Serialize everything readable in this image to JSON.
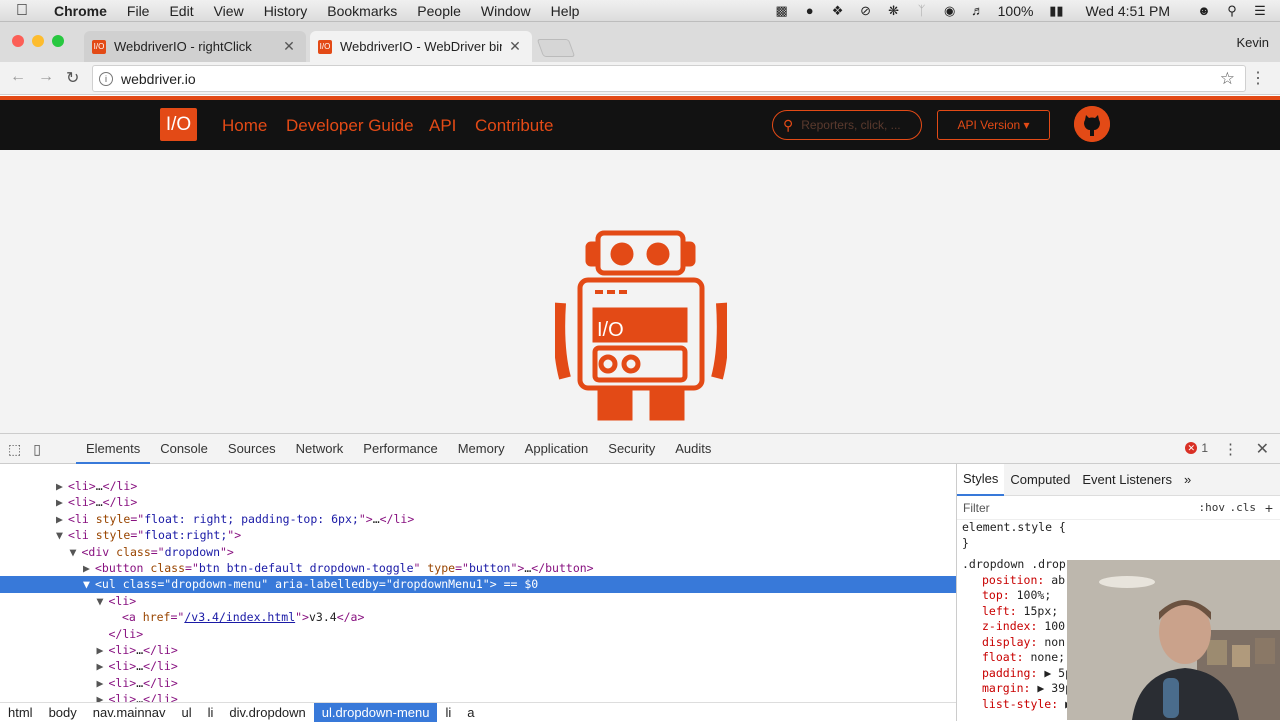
{
  "menubar": {
    "app": "Chrome",
    "items": [
      "File",
      "Edit",
      "View",
      "History",
      "Bookmarks",
      "People",
      "Window",
      "Help"
    ],
    "battery": "100%",
    "clock": "Wed 4:51 PM"
  },
  "tabs": [
    {
      "title": "WebdriverIO - rightClick",
      "favicon": "I/O"
    },
    {
      "title": "WebdriverIO - WebDriver bindi",
      "favicon": "I/O"
    }
  ],
  "profile": "Kevin",
  "address": {
    "url": "webdriver.io"
  },
  "site": {
    "logo": "I/O",
    "nav": [
      "Home",
      "Developer Guide",
      "API",
      "Contribute"
    ],
    "search_placeholder": "Reporters, click, ...",
    "api_version": "API Version ▾"
  },
  "devtools": {
    "tabs": [
      "Elements",
      "Console",
      "Sources",
      "Network",
      "Performance",
      "Memory",
      "Application",
      "Security",
      "Audits"
    ],
    "error_count": "1",
    "dom_lines": [
      {
        "indent": 0,
        "arrow": "▶",
        "parts": [
          [
            "tag",
            "<li>"
          ],
          [
            "txt",
            "…"
          ],
          [
            "tag",
            "</li>"
          ]
        ]
      },
      {
        "indent": 0,
        "arrow": "▶",
        "parts": [
          [
            "tag",
            "<li>"
          ],
          [
            "txt",
            "…"
          ],
          [
            "tag",
            "</li>"
          ]
        ]
      },
      {
        "indent": 0,
        "arrow": "▶",
        "parts": [
          [
            "tag",
            "<li "
          ],
          [
            "an",
            "style"
          ],
          [
            "tag",
            "=\""
          ],
          [
            "av",
            "float: right; padding-top: 6px;"
          ],
          [
            "tag",
            "\">"
          ],
          [
            "txt",
            "…"
          ],
          [
            "tag",
            "</li>"
          ]
        ]
      },
      {
        "indent": 0,
        "arrow": "▼",
        "parts": [
          [
            "tag",
            "<li "
          ],
          [
            "an",
            "style"
          ],
          [
            "tag",
            "=\""
          ],
          [
            "av",
            "float:right;"
          ],
          [
            "tag",
            "\">"
          ]
        ]
      },
      {
        "indent": 1,
        "arrow": "▼",
        "parts": [
          [
            "tag",
            "<div "
          ],
          [
            "an",
            "class"
          ],
          [
            "tag",
            "=\""
          ],
          [
            "av",
            "dropdown"
          ],
          [
            "tag",
            "\">"
          ]
        ]
      },
      {
        "indent": 2,
        "arrow": "▶",
        "parts": [
          [
            "tag",
            "<button "
          ],
          [
            "an",
            "class"
          ],
          [
            "tag",
            "=\""
          ],
          [
            "av",
            "btn btn-default dropdown-toggle"
          ],
          [
            "tag",
            "\" "
          ],
          [
            "an",
            "type"
          ],
          [
            "tag",
            "=\""
          ],
          [
            "av",
            "button"
          ],
          [
            "tag",
            "\">"
          ],
          [
            "txt",
            "…"
          ],
          [
            "tag",
            "</button>"
          ]
        ]
      },
      {
        "indent": 2,
        "arrow": "▼",
        "sel": true,
        "parts": [
          [
            "tag",
            "<ul "
          ],
          [
            "an",
            "class"
          ],
          [
            "tag",
            "=\""
          ],
          [
            "av",
            "dropdown-menu"
          ],
          [
            "tag",
            "\" "
          ],
          [
            "an",
            "aria-labelledby"
          ],
          [
            "tag",
            "=\""
          ],
          [
            "av",
            "dropdownMenu1"
          ],
          [
            "tag",
            "\">"
          ],
          [
            "txt",
            " == $0"
          ]
        ]
      },
      {
        "indent": 3,
        "arrow": "▼",
        "parts": [
          [
            "tag",
            "<li>"
          ]
        ]
      },
      {
        "indent": 4,
        "arrow": "",
        "parts": [
          [
            "tag",
            "<a "
          ],
          [
            "an",
            "href"
          ],
          [
            "tag",
            "=\""
          ],
          [
            "link",
            "/v3.4/index.html"
          ],
          [
            "tag",
            "\">"
          ],
          [
            "txt",
            "v3.4"
          ],
          [
            "tag",
            "</a>"
          ]
        ]
      },
      {
        "indent": 3,
        "arrow": "",
        "parts": [
          [
            "tag",
            "</li>"
          ]
        ]
      },
      {
        "indent": 3,
        "arrow": "▶",
        "parts": [
          [
            "tag",
            "<li>"
          ],
          [
            "txt",
            "…"
          ],
          [
            "tag",
            "</li>"
          ]
        ]
      },
      {
        "indent": 3,
        "arrow": "▶",
        "parts": [
          [
            "tag",
            "<li>"
          ],
          [
            "txt",
            "…"
          ],
          [
            "tag",
            "</li>"
          ]
        ]
      },
      {
        "indent": 3,
        "arrow": "▶",
        "parts": [
          [
            "tag",
            "<li>"
          ],
          [
            "txt",
            "…"
          ],
          [
            "tag",
            "</li>"
          ]
        ]
      },
      {
        "indent": 3,
        "arrow": "▶",
        "parts": [
          [
            "tag",
            "<li>"
          ],
          [
            "txt",
            "…"
          ],
          [
            "tag",
            "</li>"
          ]
        ]
      }
    ],
    "breadcrumbs": [
      "html",
      "body",
      "nav.mainnav",
      "ul",
      "li",
      "div.dropdown",
      "ul.dropdown-menu",
      "li",
      "a"
    ],
    "breadcrumb_active": "ul.dropdown-menu",
    "styles_tabs": [
      "Styles",
      "Computed",
      "Event Listeners",
      "»"
    ],
    "filter_placeholder": "Filter",
    "hov": ":hov",
    "cls": ".cls",
    "styles_lines": [
      {
        "type": "sel",
        "text": "element.style {"
      },
      {
        "type": "sel",
        "text": "}"
      },
      {
        "type": "gap",
        "text": ""
      },
      {
        "type": "sel",
        "text": ".dropdown .drop"
      },
      {
        "type": "prop",
        "name": "position",
        "value": " ab"
      },
      {
        "type": "prop",
        "name": "top",
        "value": " 100%;"
      },
      {
        "type": "prop",
        "name": "left",
        "value": " 15px;"
      },
      {
        "type": "prop",
        "name": "z-index",
        "value": " 100"
      },
      {
        "type": "prop",
        "name": "display",
        "value": " non"
      },
      {
        "type": "prop",
        "name": "float",
        "value": " none;"
      },
      {
        "type": "prop",
        "name": "padding",
        "value": " ▶ 5p"
      },
      {
        "type": "prop",
        "name": "margin",
        "value": " ▶ 39p"
      },
      {
        "type": "prop",
        "name": "list-style",
        "value": " ▶"
      }
    ]
  },
  "colors": {
    "accent": "#e34a16",
    "selection": "#3879d9"
  }
}
